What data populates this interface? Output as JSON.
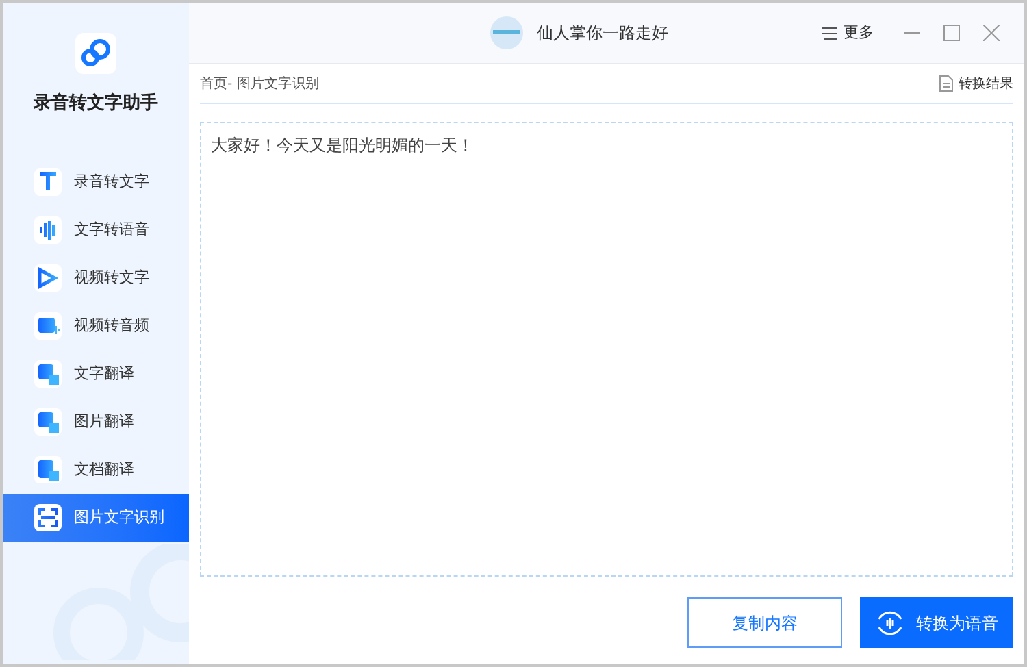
{
  "app": {
    "name": "录音转文字助手"
  },
  "sidebar": {
    "items": [
      {
        "label": "录音转文字",
        "selected": false
      },
      {
        "label": "文字转语音",
        "selected": false
      },
      {
        "label": "视频转文字",
        "selected": false
      },
      {
        "label": "视频转音频",
        "selected": false
      },
      {
        "label": "文字翻译",
        "selected": false
      },
      {
        "label": "图片翻译",
        "selected": false
      },
      {
        "label": "文档翻译",
        "selected": false
      },
      {
        "label": "图片文字识别",
        "selected": true
      }
    ]
  },
  "titlebar": {
    "user": "仙人掌你一路走好",
    "more": "更多"
  },
  "breadcrumb": "首页- 图片文字识别",
  "result_link": "转换结果",
  "text_area": {
    "value": "大家好！今天又是阳光明媚的一天！"
  },
  "buttons": {
    "copy": "复制内容",
    "convert": "转换为语音"
  }
}
